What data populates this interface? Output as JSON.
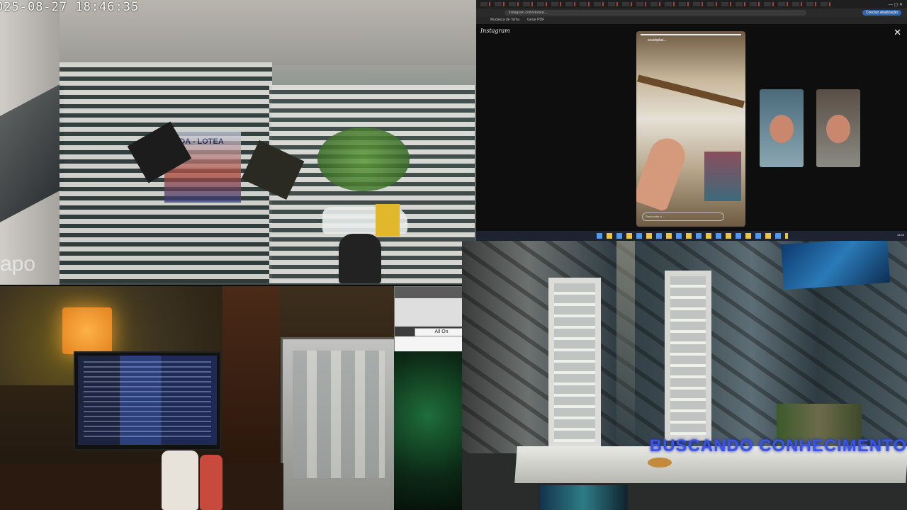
{
  "camera_gate": {
    "timestamp": "025-08-27  18:46:35",
    "watermark": "apo",
    "sign_text": "ENDA - LOTEA"
  },
  "browser": {
    "url": "instagram.com/stories/...",
    "profile_button": "Concluir atualização",
    "bookmarks": [
      "Mudança de Tema",
      "Gerar PDF"
    ],
    "instagram_logo": "Instagram",
    "close_icon": "close-icon",
    "story_username": "acadsplas...",
    "story_reply_placeholder": "Responder a ..."
  },
  "dialog": {
    "button_label": "All On"
  },
  "camera_studio": {
    "overlay_text": "BUSCANDO CONHECIMENTO"
  },
  "colors": {
    "overlay_blue": "#3a55e6",
    "lamp_orange": "#e2831c",
    "taskbar_bg": "#1d2330"
  }
}
